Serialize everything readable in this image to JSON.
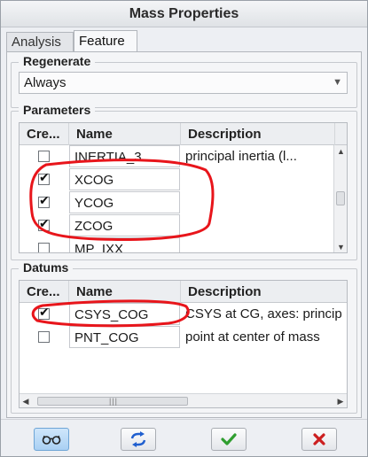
{
  "window": {
    "title": "Mass Properties"
  },
  "tabs": [
    {
      "label": "Analysis",
      "active": false
    },
    {
      "label": "Feature",
      "active": true
    }
  ],
  "regenerate": {
    "title": "Regenerate",
    "selected": "Always"
  },
  "parameters": {
    "title": "Parameters",
    "columns": [
      "Cre...",
      "Name",
      "Description"
    ],
    "rows": [
      {
        "checked": false,
        "name": "INERTIA_3",
        "description": "principal inertia (l..."
      },
      {
        "checked": true,
        "name": "XCOG",
        "description": ""
      },
      {
        "checked": true,
        "name": "YCOG",
        "description": ""
      },
      {
        "checked": true,
        "name": "ZCOG",
        "description": ""
      },
      {
        "checked": false,
        "name": "MP_IXX",
        "description": ""
      }
    ]
  },
  "datums": {
    "title": "Datums",
    "columns": [
      "Cre...",
      "Name",
      "Description"
    ],
    "rows": [
      {
        "checked": true,
        "name": "CSYS_COG",
        "description": "CSYS at CG, axes: princip"
      },
      {
        "checked": false,
        "name": "PNT_COG",
        "description": "point at center of mass"
      }
    ]
  },
  "buttons": [
    {
      "icon": "glasses-icon",
      "pressed": true
    },
    {
      "icon": "regenerate-icon",
      "pressed": false
    },
    {
      "icon": "ok-checkmark-icon",
      "pressed": false
    },
    {
      "icon": "cancel-x-icon",
      "pressed": false
    }
  ],
  "colors": {
    "annotation": "#e8151b",
    "ok": "#2f9e2f",
    "cancel": "#cc1f1f",
    "refresh": "#1f5fcf"
  }
}
